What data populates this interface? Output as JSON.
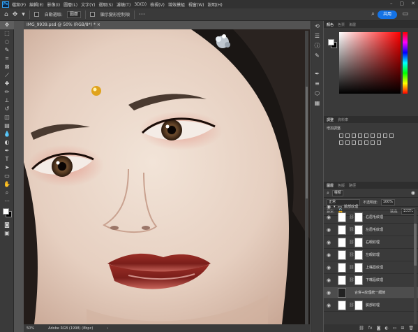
{
  "app": {
    "logo": "Ps"
  },
  "menu": [
    "檔案(F)",
    "編輯(E)",
    "影像(I)",
    "圖層(L)",
    "文字(Y)",
    "選取(S)",
    "濾鏡(T)",
    "3D(D)",
    "檢視(V)",
    "增效模組",
    "視窗(W)",
    "說明(H)"
  ],
  "options": {
    "auto_select_label": "自動選取:",
    "auto_select_value": "圖層",
    "show_transform_label": "顯示變形控制項",
    "share_label": "共用"
  },
  "document": {
    "tab_title": "IMG_9939.psd @ 50% (RGB/8*) *",
    "zoom": "50%",
    "profile": "Adobe RGB (1998) (8bpc)"
  },
  "color_panel": {
    "tabs": [
      "顏色",
      "色票",
      "漸層"
    ],
    "fg": "#ffffff",
    "bg": "#000000"
  },
  "adjust_panel": {
    "tabs": [
      "調整",
      "資料庫"
    ],
    "title": "增加調整"
  },
  "layers_panel": {
    "tabs": [
      "圖層",
      "色版",
      "路徑"
    ],
    "filter_label": "種類",
    "blend_mode": "正常",
    "opacity_label": "不透明度:",
    "opacity_value": "100%",
    "lock_label": "鎖定:",
    "fill_label": "填滿:",
    "fill_value": "100%",
    "group_name": "臉部紋理",
    "layers": [
      {
        "name": "右眉毛紋理"
      },
      {
        "name": "左眉毛紋理"
      },
      {
        "name": "右眼紋理"
      },
      {
        "name": "左眼紋理"
      },
      {
        "name": "上嘴唇紋理"
      },
      {
        "name": "下嘴唇紋理"
      },
      {
        "name": "合併+紋理統一細節"
      },
      {
        "name": "臉部紋理"
      }
    ]
  }
}
